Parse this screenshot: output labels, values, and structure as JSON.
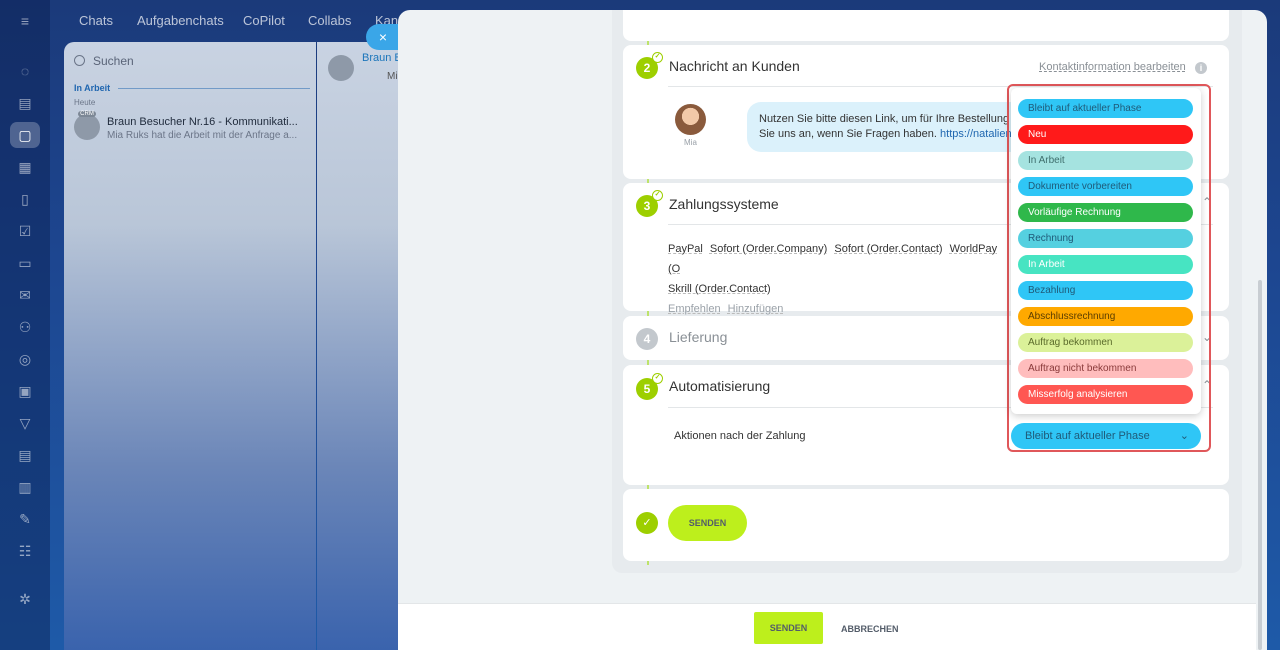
{
  "topnav": {
    "tabs": [
      "Chats",
      "Aufgabenchats",
      "CoPilot",
      "Collabs",
      "Kan"
    ]
  },
  "chatlist": {
    "search_placeholder": "Suchen",
    "group_label": "In Arbeit",
    "date_label": "Heute",
    "avatar_badge": "CRM",
    "chat_title": "Braun Besucher Nr.16 - Kommunikati...",
    "chat_preview": "Mia Ruks hat die Arbeit mit der Anfrage a...",
    "chat_title_right": "Braun B",
    "chat_sub_right": "Mi"
  },
  "close_label": "×",
  "sections": {
    "s2": {
      "num": "2",
      "title": "Nachricht an Kunden",
      "edit_link": "Kontaktinformation bearbeiten",
      "info": "i",
      "avatar_name": "Mia",
      "bubble_line1": "Nutzen Sie bitte diesen Link, um für Ihre Bestellung",
      "bubble_line2_text": "Sie uns an, wenn Sie Fragen haben. ",
      "bubble_link": "https://natalien"
    },
    "s3": {
      "num": "3",
      "title": "Zahlungssysteme",
      "systems": [
        "PayPal",
        "Sofort (Order.Company)",
        "Sofort (Order.Contact)",
        "WorldPay (O",
        "Skrill (Order.Contact)"
      ],
      "recommend": "Empfehlen",
      "add": "Hinzufügen"
    },
    "s4": {
      "num": "4",
      "title": "Lieferung"
    },
    "s5": {
      "num": "5",
      "title": "Automatisierung",
      "actions_label": "Aktionen nach der Zahlung"
    },
    "send_inline": "SENDEN"
  },
  "footer": {
    "send": "SENDEN",
    "cancel": "ABBRECHEN"
  },
  "dropdown": {
    "selected": "Bleibt auf aktueller Phase",
    "options": [
      {
        "label": "Bleibt auf aktueller Phase",
        "color": "#2fc6f6",
        "text": "#1f5a78"
      },
      {
        "label": "Neu",
        "color": "#ff1a1a",
        "text": "#ffffff"
      },
      {
        "label": "In Arbeit",
        "color": "#a5e3e0",
        "text": "#3e6e6c"
      },
      {
        "label": "Dokumente vorbereiten",
        "color": "#2fc6f6",
        "text": "#1f5a78"
      },
      {
        "label": "Vorläufige Rechnung",
        "color": "#2fb84b",
        "text": "#ffffff"
      },
      {
        "label": "Rechnung",
        "color": "#55d0e0",
        "text": "#1f5a78"
      },
      {
        "label": "In Arbeit",
        "color": "#47e4c2",
        "text": "#ffffff"
      },
      {
        "label": "Bezahlung",
        "color": "#2fc6f6",
        "text": "#1f5a78"
      },
      {
        "label": "Abschlussrechnung",
        "color": "#ffa900",
        "text": "#5a3d00"
      },
      {
        "label": "Auftrag bekommen",
        "color": "#dbf199",
        "text": "#5a6a2a"
      },
      {
        "label": "Auftrag nicht bekommen",
        "color": "#ffbdbd",
        "text": "#8a3a3a"
      },
      {
        "label": "Misserfolg analysieren",
        "color": "#ff5752",
        "text": "#ffffff"
      }
    ]
  }
}
